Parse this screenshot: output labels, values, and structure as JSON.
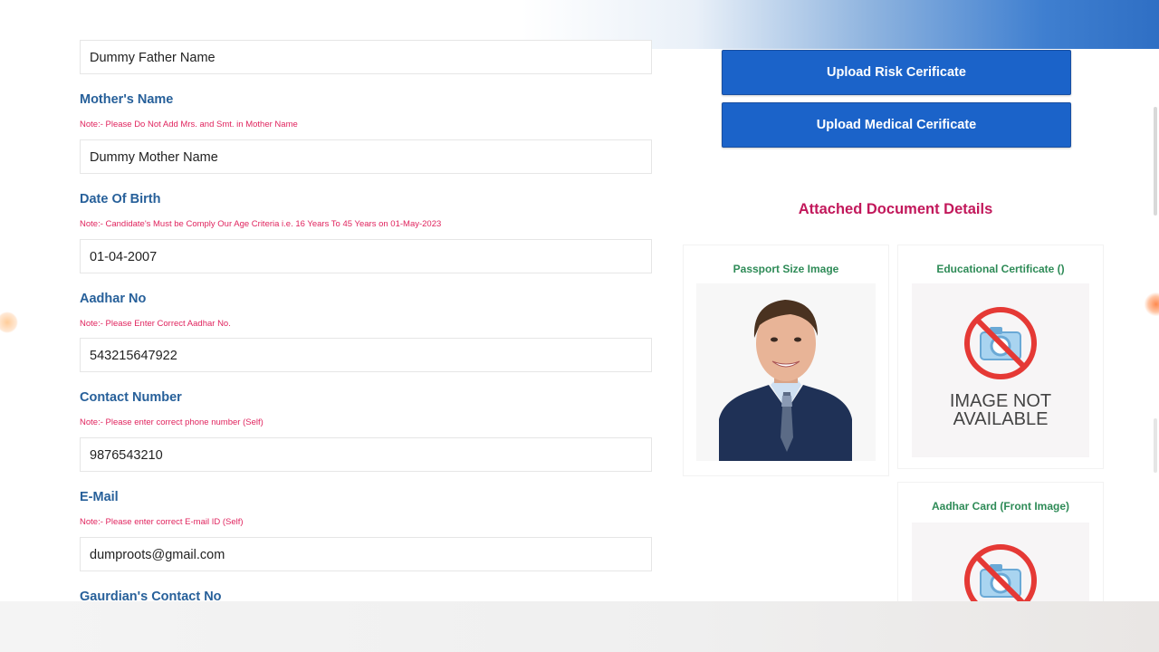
{
  "form": {
    "father_value": "Dummy Father Name",
    "mother": {
      "label": "Mother's Name",
      "note": "Note:- Please Do Not Add Mrs. and Smt. in Mother Name",
      "value": "Dummy Mother Name"
    },
    "dob": {
      "label": "Date Of Birth",
      "note": "Note:- Candidate's Must be Comply Our Age Criteria i.e. 16 Years To 45 Years on 01-May-2023",
      "value": "01-04-2007"
    },
    "aadhar": {
      "label": "Aadhar No",
      "note": "Note:- Please Enter Correct Aadhar No.",
      "value": "543215647922"
    },
    "contact": {
      "label": "Contact Number",
      "note": "Note:- Please enter correct phone number (Self)",
      "value": "9876543210"
    },
    "email": {
      "label": "E-Mail",
      "note": "Note:- Please enter correct E-mail ID (Self)",
      "value": "dumproots@gmail.com"
    },
    "guardian": {
      "label": "Gaurdian's Contact No"
    }
  },
  "actions": {
    "upload_risk": "Upload Risk Cerificate",
    "upload_medical": "Upload Medical Cerificate"
  },
  "documents": {
    "title": "Attached Document Details",
    "passport": {
      "title": "Passport Size Image"
    },
    "education": {
      "title": "Educational Certificate ()",
      "placeholder_line1": "IMAGE NOT",
      "placeholder_line2": "AVAILABLE"
    },
    "aadhar_front": {
      "title": "Aadhar Card (Front Image)"
    }
  },
  "icons": [
    "no-camera-icon",
    "person-photo"
  ],
  "colors": {
    "label": "#27609a",
    "note": "#e0245e",
    "button": "#1b63c9",
    "section_title": "#c2185b",
    "card_title": "#2e8b57"
  }
}
